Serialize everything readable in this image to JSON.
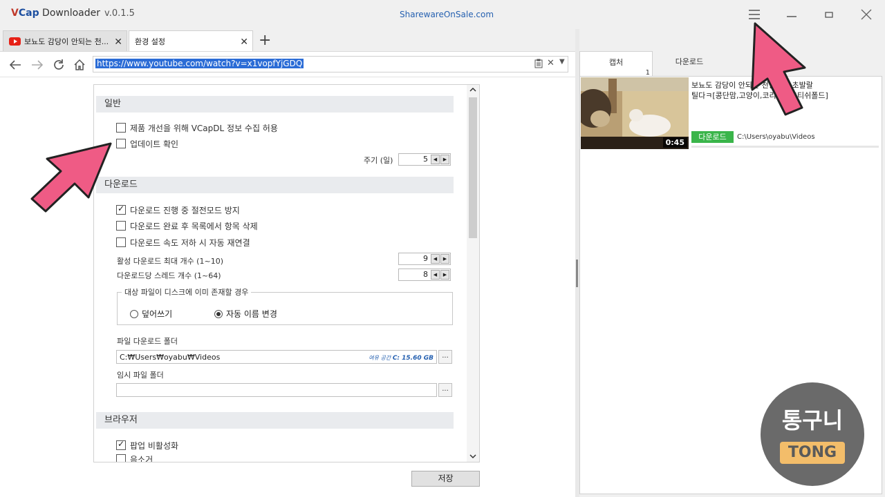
{
  "app": {
    "name_prefix_v": "V",
    "name_prefix_cap": "Cap",
    "name_rest": " Downloader",
    "version": "v.0.1.5",
    "sponsor": "SharewareOnSale.com"
  },
  "window": {
    "menu_icon": "menu-icon",
    "minimize_icon": "minimize-icon",
    "maximize_icon": "maximize-icon",
    "close_icon": "close-icon"
  },
  "tabs": [
    {
      "label": "보뇨도 감당이 안되는 천...",
      "icon": "youtube-icon"
    },
    {
      "label": "환경 설정"
    }
  ],
  "nav": {
    "url": "https://www.youtube.com/watch?v=x1vopfYjGDQ"
  },
  "settings": {
    "general": {
      "header": "일반",
      "collect_info": "제품 개선을 위해 VCapDL 정보 수집 허용",
      "check_update": "업데이트 확인",
      "period_label": "주기 (일)",
      "period_value": "5"
    },
    "download": {
      "header": "다운로드",
      "prevent_sleep": "다운로드 진행 중 절전모드 방지",
      "remove_after": "다운로드 완료 후 목록에서 항목 삭제",
      "auto_reconnect": "다운로드 속도 저하 시 자동 재연결",
      "max_active_label": "활성 다운로드 최대 개수 (1~10)",
      "max_active_value": "9",
      "threads_label": "다운로드당 스레드 개수 (1~64)",
      "threads_value": "8",
      "exists_title": "대상 파일이 디스크에 이미 존재할 경우",
      "overwrite": "덮어쓰기",
      "auto_rename": "자동 이름 변경",
      "folder_label": "파일 다운로드 폴더",
      "folder_value": "C:₩Users₩oyabu₩Videos",
      "free_space_prefix": "여유 공간",
      "free_space_value": "C: 15.60 GB",
      "temp_label": "임시 파일 폴더",
      "temp_value": "",
      "browse": "..."
    },
    "browser": {
      "header": "브라우저",
      "disable_popup": "팝업 비활성화",
      "mute": "음소거"
    },
    "save": "저장"
  },
  "right_panel": {
    "tab_capture": "캡처",
    "capture_count": "1",
    "tab_download": "다운로드",
    "item": {
      "title_line1": "보뇨도 감당이 안되는 천방지축 초발랄",
      "title_line2": "틸다ㅋ[콩단맘,고양이,코리안스코티쉬폴드]",
      "duration": "0:45",
      "download_label": "다운로드",
      "path": "C:\\Users\\oyabu\\Videos"
    }
  },
  "watermark": {
    "top": "통구니",
    "bottom": "TONG"
  },
  "colors": {
    "accent_blue": "#2b6cd6",
    "download_green": "#3ab54a",
    "arrow_pink": "#ef5b85",
    "watermark_gray": "#6a6a6a",
    "watermark_gold": "#f3bd6a"
  }
}
